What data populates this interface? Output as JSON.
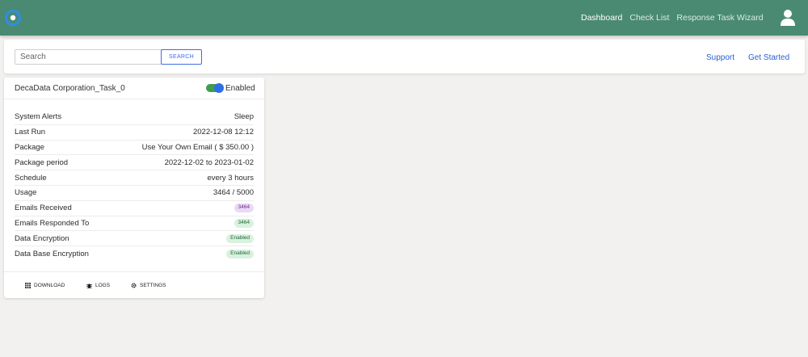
{
  "colors": {
    "navbar": "#4a8a73",
    "accent_blue": "#2a5fd6",
    "toggle_track": "#3f9e4d",
    "toggle_knob": "#2f6ee5"
  },
  "nav": {
    "logo_icon": "app-logo-icon",
    "links": [
      {
        "label": "Dashboard",
        "active": true
      },
      {
        "label": "Check List",
        "active": false
      },
      {
        "label": "Response Task Wizard",
        "active": false
      }
    ],
    "avatar_icon": "user-avatar-icon"
  },
  "search": {
    "placeholder": "Search",
    "value": "",
    "button_label": "SEARCH"
  },
  "top_links": {
    "support": "Support",
    "get_started": "Get Started"
  },
  "task_card": {
    "title": "DecaData Corporation_Task_0",
    "toggle_on": true,
    "toggle_label": "Enabled",
    "rows": [
      {
        "label": "System Alerts",
        "value": "Sleep"
      },
      {
        "label": "Last Run",
        "value": "2022-12-08 12:12"
      },
      {
        "label": "Package",
        "value": "Use Your Own Email ( $ 350.00 )"
      },
      {
        "label": "Package period",
        "value": "2022-12-02 to 2023-01-02"
      },
      {
        "label": "Schedule",
        "value": "every 3 hours"
      },
      {
        "label": "Usage",
        "value": "3464 / 5000"
      },
      {
        "label": "Emails Received",
        "value": "3464"
      },
      {
        "label": "Emails Responded To",
        "value": "3464"
      },
      {
        "label": "Data Encryption",
        "value": "Enabled"
      },
      {
        "label": "Data Base Encryption",
        "value": "Enabled"
      }
    ],
    "footer": {
      "download": "DOWNLOAD",
      "logs": "LOGS",
      "settings": "SETTINGS",
      "download_icon": "grid-icon",
      "logs_icon": "bug-icon",
      "settings_icon": "gear-icon"
    }
  }
}
